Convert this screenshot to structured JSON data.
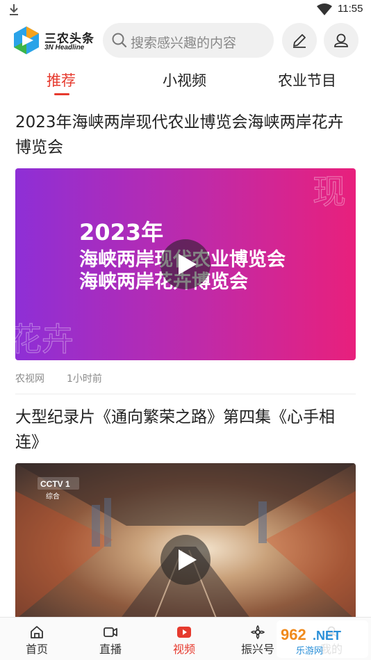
{
  "status_bar": {
    "time": "11:55"
  },
  "header": {
    "logo_cn": "三农头条",
    "logo_en": "3N Headline",
    "search_placeholder": "搜索感兴趣的内容"
  },
  "tabs": [
    {
      "label": "推荐",
      "active": true
    },
    {
      "label": "小视频",
      "active": false
    },
    {
      "label": "农业节目",
      "active": false
    }
  ],
  "articles": [
    {
      "title": "2023年海峡两岸现代农业博览会海峡两岸花卉博览会",
      "cover_lines": [
        "2023年",
        "海峡两岸现代农业博览会",
        "海峡两岸花卉博览会"
      ],
      "cover_bg_text_1": "现",
      "cover_bg_text_2": "花卉",
      "source": "农视网",
      "time": "1小时前"
    },
    {
      "title": "大型纪录片《通向繁荣之路》第四集《心手相连》",
      "channel_logo": "CCTV 1",
      "channel_sub": "综合"
    }
  ],
  "bottom_nav": [
    {
      "label": "首页",
      "icon": "home-icon",
      "active": false
    },
    {
      "label": "直播",
      "icon": "live-camera-icon",
      "active": false
    },
    {
      "label": "视频",
      "icon": "video-play-icon",
      "active": true
    },
    {
      "label": "振兴号",
      "icon": "flower-icon",
      "active": false
    },
    {
      "label": "我的",
      "icon": "profile-icon",
      "active": false
    }
  ],
  "watermark": "962.NET 乐游网",
  "colors": {
    "accent": "#e63a2e",
    "cover1_left": "#8e2fd6",
    "cover1_right": "#e8207c"
  }
}
